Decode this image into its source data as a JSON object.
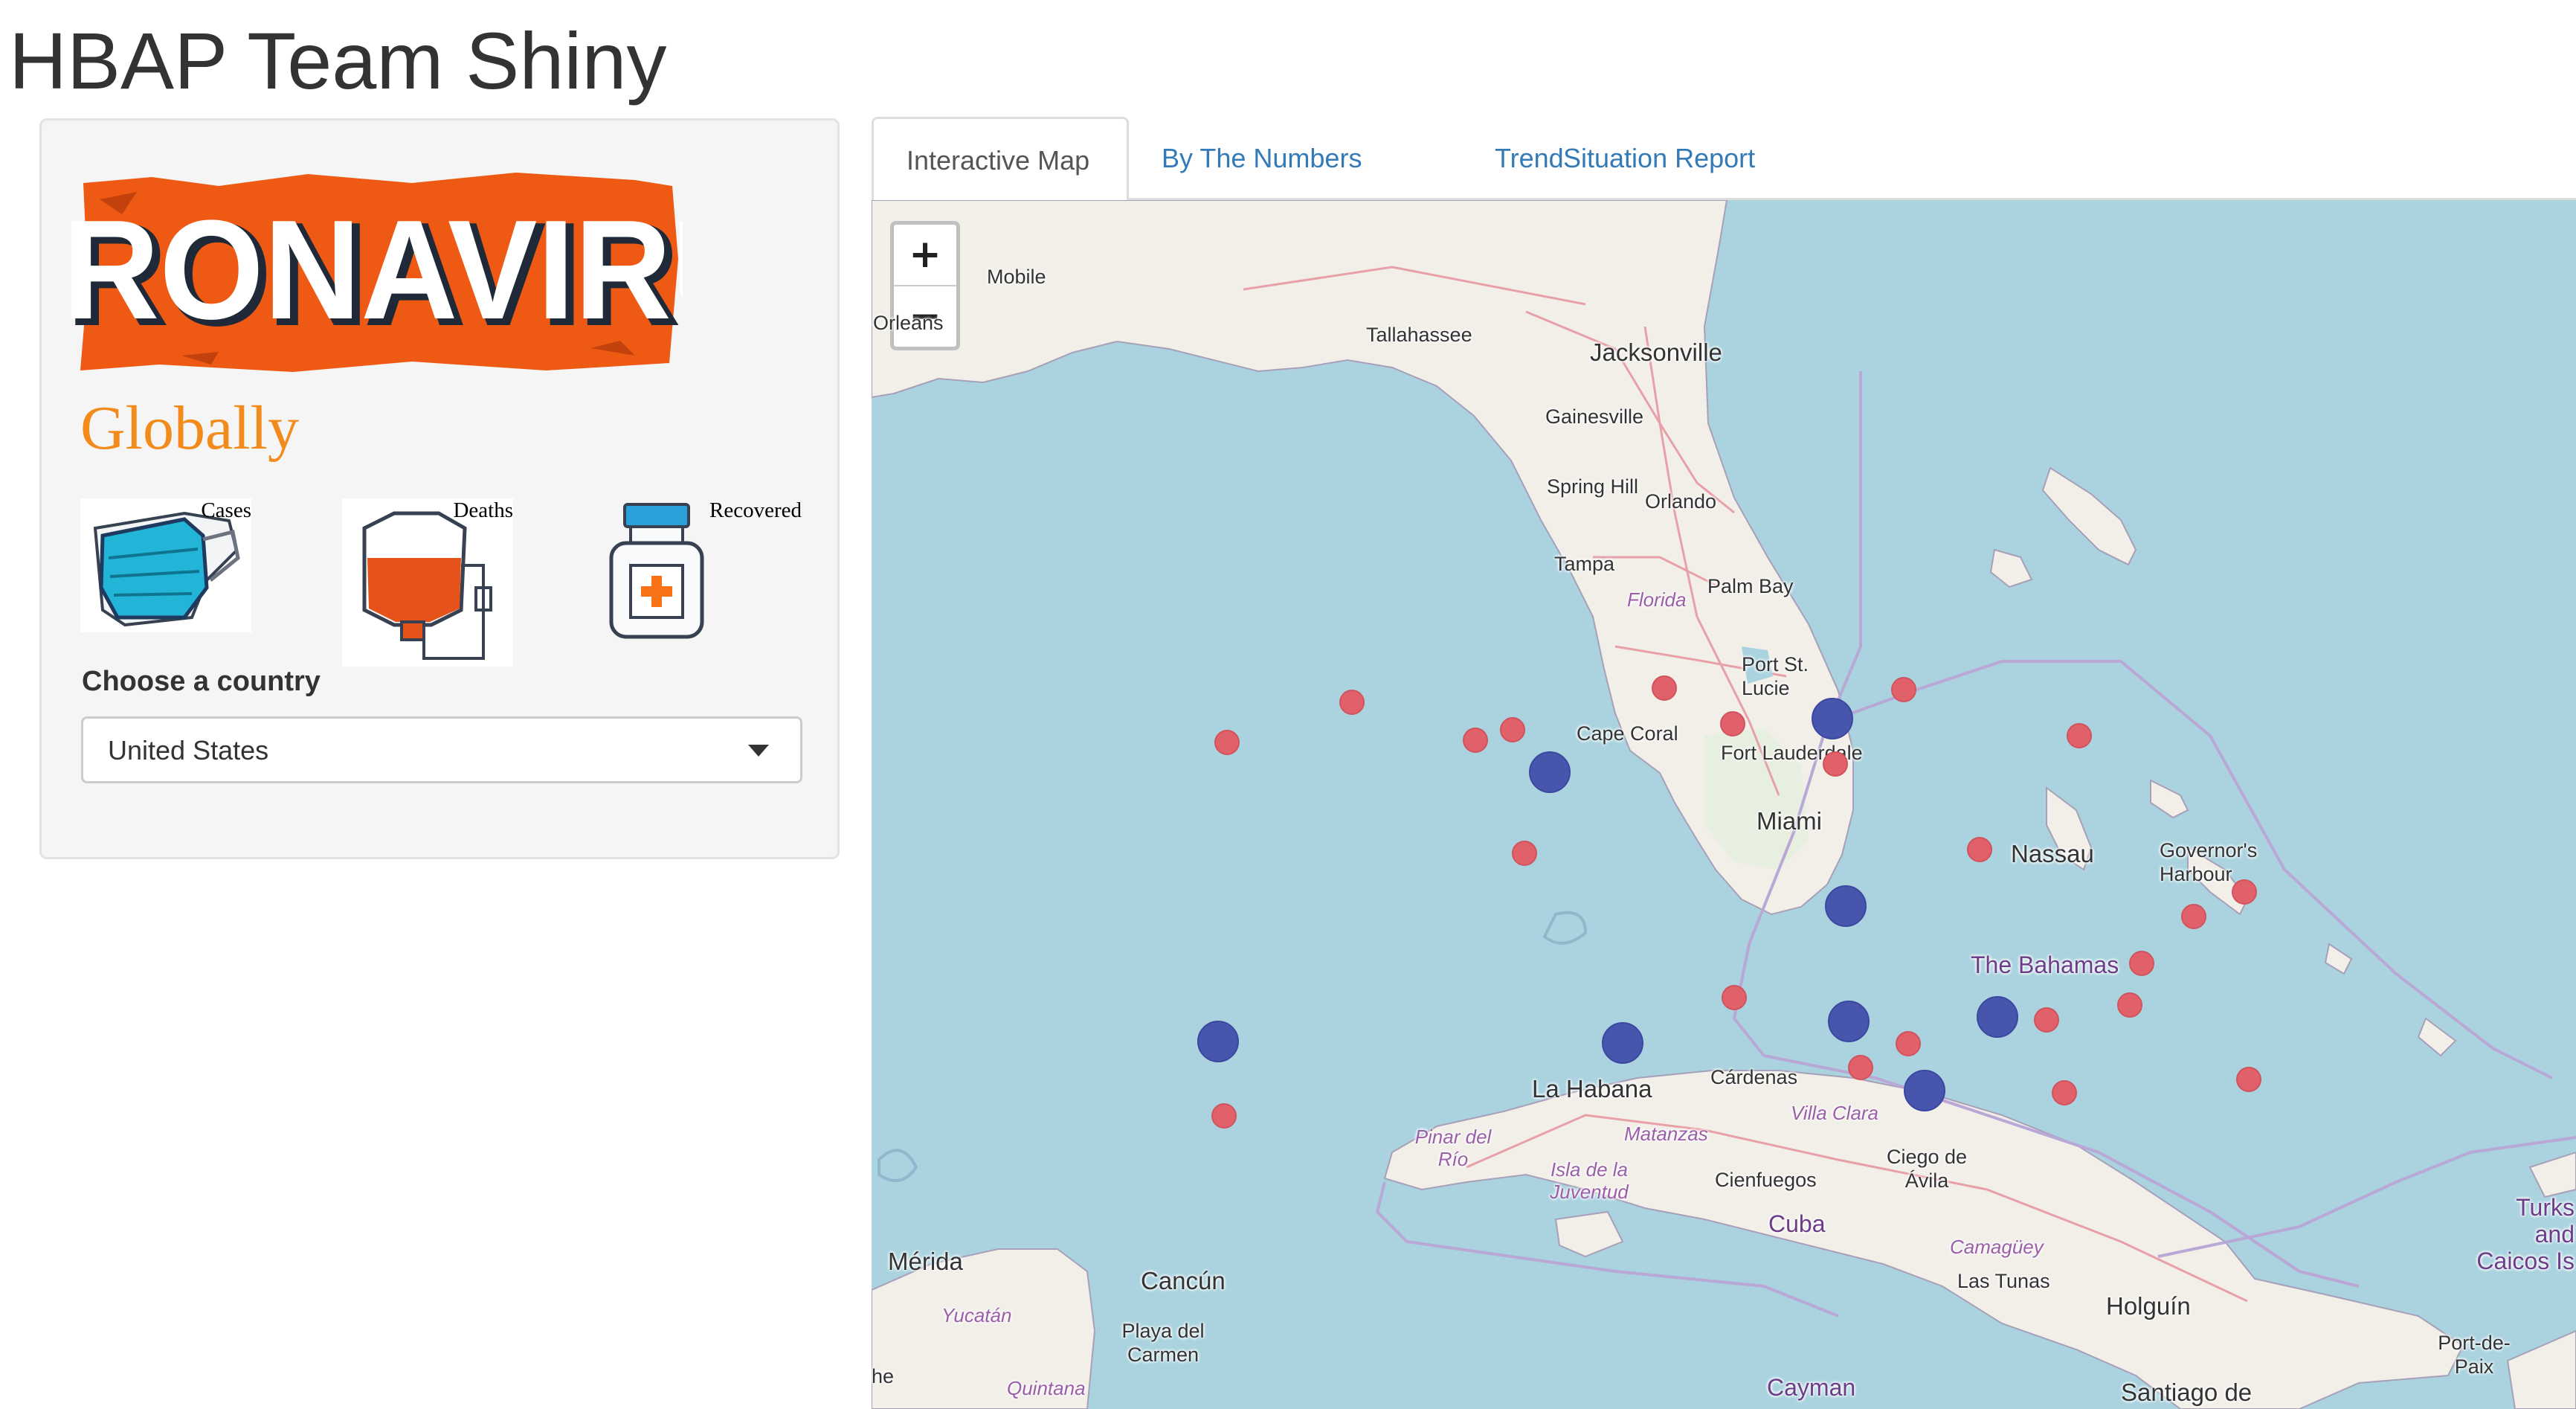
{
  "app": {
    "title": "HBAP Team Shiny"
  },
  "sidebar": {
    "logo_text": "CORONAVIRUS",
    "heading": "Globally",
    "stats": [
      {
        "label": "Cases",
        "icon": "face-mask-icon"
      },
      {
        "label": "Deaths",
        "icon": "blood-bag-icon"
      },
      {
        "label": "Recovered",
        "icon": "medicine-bottle-icon"
      }
    ],
    "country_label": "Choose a country",
    "country_selected": "United States"
  },
  "tabs": [
    {
      "label": "Interactive Map",
      "active": true
    },
    {
      "label": "By The Numbers",
      "active": false
    },
    {
      "label": "Trend",
      "active": false
    },
    {
      "label": "Situation Report",
      "active": false
    }
  ],
  "map": {
    "zoom_in": "+",
    "zoom_out": "−",
    "places": [
      "Mobile",
      "Orleans",
      "Tallahassee",
      "Jacksonville",
      "Gainesville",
      "Spring Hill",
      "Orlando",
      "Tampa",
      "Florida",
      "Palm Bay",
      "Port St. Lucie",
      "Cape Coral",
      "Fort Lauderdale",
      "Miami",
      "Nassau",
      "Governor's Harbour",
      "The Bahamas",
      "La Habana",
      "Cárdenas",
      "Villa Clara",
      "Pinar del Río",
      "Matanzas",
      "Isla de la Juventud",
      "Cienfuegos",
      "Ciego de Ávila",
      "Cuba",
      "Camagüey",
      "Las Tunas",
      "Holguín",
      "Mérida",
      "Cancún",
      "Yucatán",
      "Playa del Carmen",
      "Quintana",
      "Cayman",
      "Santiago de",
      "Turks and Caicos Is",
      "Port-de-Paix",
      "he"
    ],
    "colors": {
      "water": "#aad3df",
      "land": "#f2efe9",
      "red_marker": "#e0616a",
      "blue_marker": "#4855ad"
    }
  }
}
